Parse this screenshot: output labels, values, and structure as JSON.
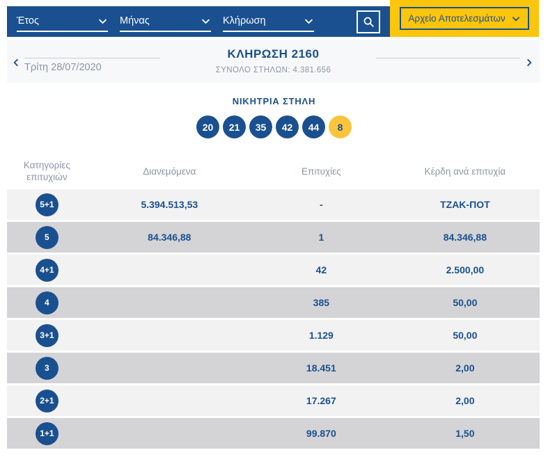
{
  "colors": {
    "primary_blue": "#1a508f",
    "accent_yellow": "#fdc50b",
    "joker_ball_yellow": "#fcc43d",
    "row_light": "#f2f2f3",
    "row_dark": "#d4d4d6",
    "strip_background": "#f7f8f9",
    "muted_text": "#8c95a5"
  },
  "topbar": {
    "dropdowns": [
      {
        "label": "Έτος"
      },
      {
        "label": "Μήνας"
      },
      {
        "label": "Κλήρωση"
      }
    ],
    "archive_button_label": "Αρχείο Αποτελεσμάτων"
  },
  "draw_header": {
    "date": "Τρίτη 28/07/2020",
    "title": "ΚΛΗΡΩΣΗ 2160",
    "total_label": "ΣΥΝΟΛΟ ΣΤΗΛΩΝ: 4.381.656"
  },
  "winning": {
    "title": "ΝΙΚΗΤΡΙΑ ΣΤΗΛΗ",
    "numbers": [
      "20",
      "21",
      "35",
      "42",
      "44"
    ],
    "joker": "8"
  },
  "table": {
    "headers": [
      "Κατηγορίες επιτυχιών",
      "Διανεμόμενα",
      "Επιτυχίες",
      "Κέρδη ανά επιτυχία"
    ],
    "rows": [
      {
        "category": "5+1",
        "distributed": "5.394.513,53",
        "winners": "-",
        "prize": "ΤΖΑΚ-ΠΟΤ"
      },
      {
        "category": "5",
        "distributed": "84.346,88",
        "winners": "1",
        "prize": "84.346,88"
      },
      {
        "category": "4+1",
        "distributed": "",
        "winners": "42",
        "prize": "2.500,00"
      },
      {
        "category": "4",
        "distributed": "",
        "winners": "385",
        "prize": "50,00"
      },
      {
        "category": "3+1",
        "distributed": "",
        "winners": "1.129",
        "prize": "50,00"
      },
      {
        "category": "3",
        "distributed": "",
        "winners": "18.451",
        "prize": "2,00"
      },
      {
        "category": "2+1",
        "distributed": "",
        "winners": "17.267",
        "prize": "2,00"
      },
      {
        "category": "1+1",
        "distributed": "",
        "winners": "99.870",
        "prize": "1,50"
      }
    ]
  }
}
